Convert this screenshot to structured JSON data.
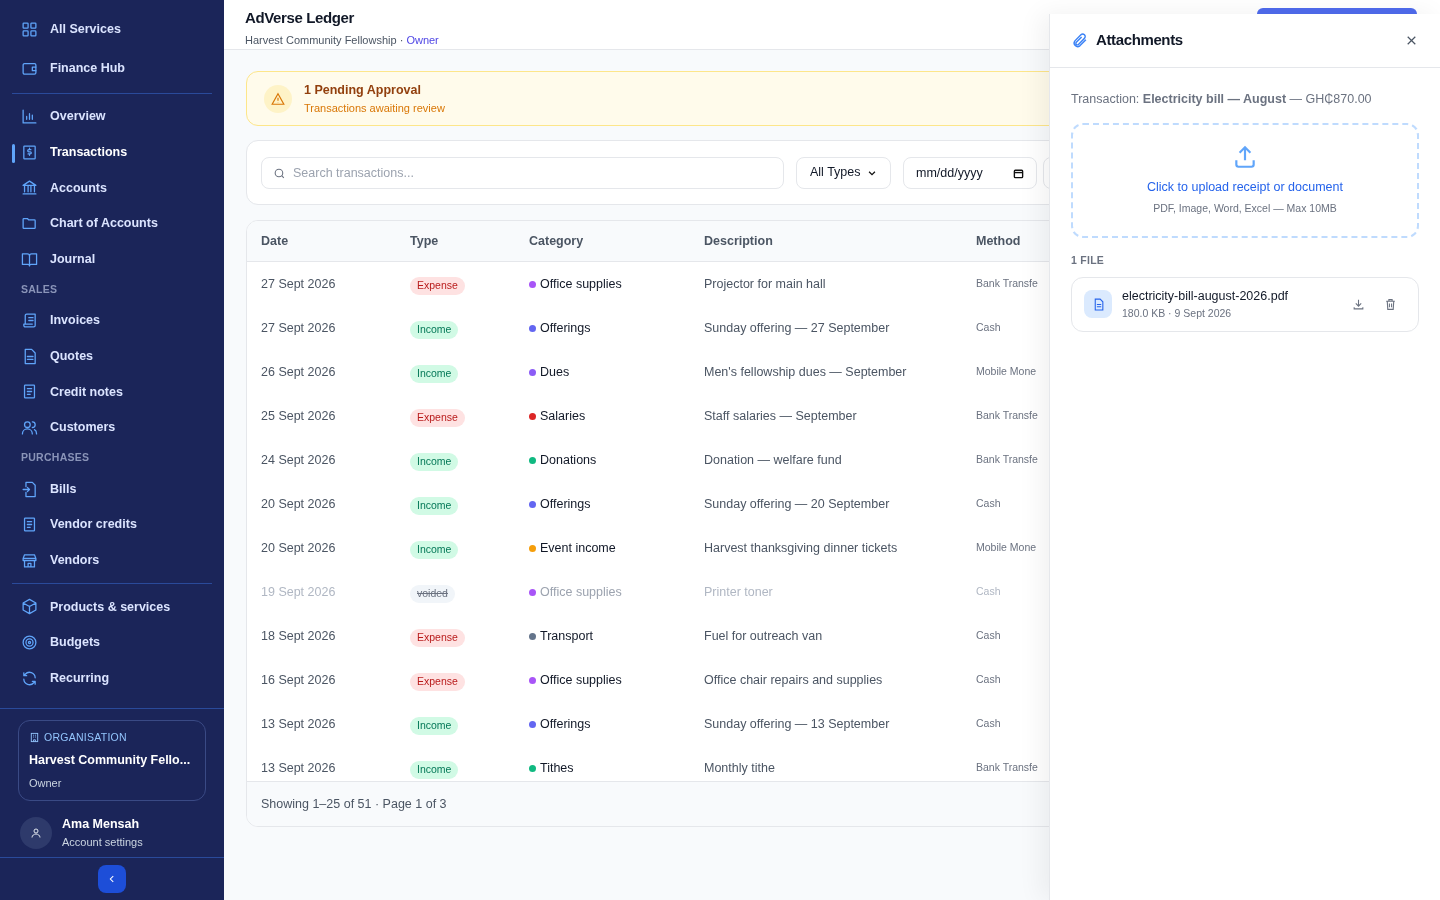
{
  "sidebar": {
    "top_items": [
      {
        "label": "All Services",
        "selected": false
      },
      {
        "label": "Finance Hub",
        "selected": false
      }
    ],
    "groups": [
      {
        "items": [
          {
            "label": "Overview",
            "selected": false
          },
          {
            "label": "Transactions",
            "selected": true
          },
          {
            "label": "Accounts",
            "selected": false
          },
          {
            "label": "Chart of Accounts",
            "selected": false
          },
          {
            "label": "Journal",
            "selected": false
          }
        ]
      },
      {
        "heading": "SALES",
        "items": [
          {
            "label": "Invoices",
            "selected": false
          },
          {
            "label": "Quotes",
            "selected": false
          },
          {
            "label": "Credit notes",
            "selected": false
          },
          {
            "label": "Customers",
            "selected": false
          }
        ]
      },
      {
        "heading": "PURCHASES",
        "items": [
          {
            "label": "Bills",
            "selected": false
          },
          {
            "label": "Vendor credits",
            "selected": false
          },
          {
            "label": "Vendors",
            "selected": false
          }
        ]
      },
      {
        "items": [
          {
            "label": "Products & services",
            "selected": false
          },
          {
            "label": "Budgets",
            "selected": false
          },
          {
            "label": "Recurring",
            "selected": false
          }
        ]
      }
    ],
    "organisation": {
      "label": "ORGANISATION",
      "name": "Harvest Community Fello...",
      "role": "Owner"
    },
    "user": {
      "name": "Ama Mensah",
      "subtitle": "Account settings"
    }
  },
  "header": {
    "title": "AdVerse Ledger",
    "org": "Harvest Community Fellowship",
    "separator": "·",
    "role": "Owner"
  },
  "banner": {
    "title": "1 Pending Approval",
    "subtitle": "Transactions awaiting review"
  },
  "filters": {
    "search": {
      "placeholder": "Search transactions..."
    },
    "type": "All Types",
    "date": {
      "placeholder": "mm/dd/yyyy"
    }
  },
  "table": {
    "columns": [
      "Date",
      "Type",
      "Category",
      "Description",
      "Method"
    ],
    "rows": [
      {
        "date": "27 Sept 2026",
        "type": {
          "kind": "expense",
          "label": "Expense"
        },
        "category": "Office supplies",
        "color": "#a855f7",
        "description": "Projector for main hall",
        "method": "Bank Transfe"
      },
      {
        "date": "27 Sept 2026",
        "type": {
          "kind": "income",
          "label": "Income"
        },
        "category": "Offerings",
        "color": "#6366f1",
        "description": "Sunday offering — 27 September",
        "method": "Cash"
      },
      {
        "date": "26 Sept 2026",
        "type": {
          "kind": "income",
          "label": "Income"
        },
        "category": "Dues",
        "color": "#8b5cf6",
        "description": "Men's fellowship dues — September",
        "method": "Mobile Mone"
      },
      {
        "date": "25 Sept 2026",
        "type": {
          "kind": "expense",
          "label": "Expense"
        },
        "category": "Salaries",
        "color": "#dc2626",
        "description": "Staff salaries — September",
        "method": "Bank Transfe"
      },
      {
        "date": "24 Sept 2026",
        "type": {
          "kind": "income",
          "label": "Income"
        },
        "category": "Donations",
        "color": "#10b981",
        "description": "Donation — welfare fund",
        "method": "Bank Transfe"
      },
      {
        "date": "20 Sept 2026",
        "type": {
          "kind": "income",
          "label": "Income"
        },
        "category": "Offerings",
        "color": "#6366f1",
        "description": "Sunday offering — 20 September",
        "method": "Cash"
      },
      {
        "date": "20 Sept 2026",
        "type": {
          "kind": "income",
          "label": "Income"
        },
        "category": "Event income",
        "color": "#f59e0b",
        "description": "Harvest thanksgiving dinner tickets",
        "method": "Mobile Mone"
      },
      {
        "date": "19 Sept 2026",
        "type": {
          "kind": "voided",
          "label": "voided"
        },
        "category": "Office supplies",
        "color": "#a855f7",
        "description": "Printer toner",
        "method": "Cash"
      },
      {
        "date": "18 Sept 2026",
        "type": {
          "kind": "expense",
          "label": "Expense"
        },
        "category": "Transport",
        "color": "#64748b",
        "description": "Fuel for outreach van",
        "method": "Cash"
      },
      {
        "date": "16 Sept 2026",
        "type": {
          "kind": "expense",
          "label": "Expense"
        },
        "category": "Office supplies",
        "color": "#a855f7",
        "description": "Office chair repairs and supplies",
        "method": "Cash"
      },
      {
        "date": "13 Sept 2026",
        "type": {
          "kind": "income",
          "label": "Income"
        },
        "category": "Offerings",
        "color": "#6366f1",
        "description": "Sunday offering — 13 September",
        "method": "Cash"
      },
      {
        "date": "13 Sept 2026",
        "type": {
          "kind": "income",
          "label": "Income"
        },
        "category": "Tithes",
        "color": "#10b981",
        "description": "Monthly tithe",
        "method": "Bank Transfe"
      }
    ],
    "footer": "Showing 1–25 of 51 · Page 1 of 3"
  },
  "attachments": {
    "title": "Attachments",
    "transaction": "Transaction: **Electricity bill — August** — GH₵870.00",
    "upload": {
      "label": "Click to upload receipt or document",
      "hint": "PDF, Image, Word, Excel — Max 10MB"
    },
    "count": "1 FILE",
    "files": [
      {
        "name": "electricity-bill-august-2026.pdf",
        "meta": "180.0 KB · 9 Sept 2026"
      }
    ]
  }
}
